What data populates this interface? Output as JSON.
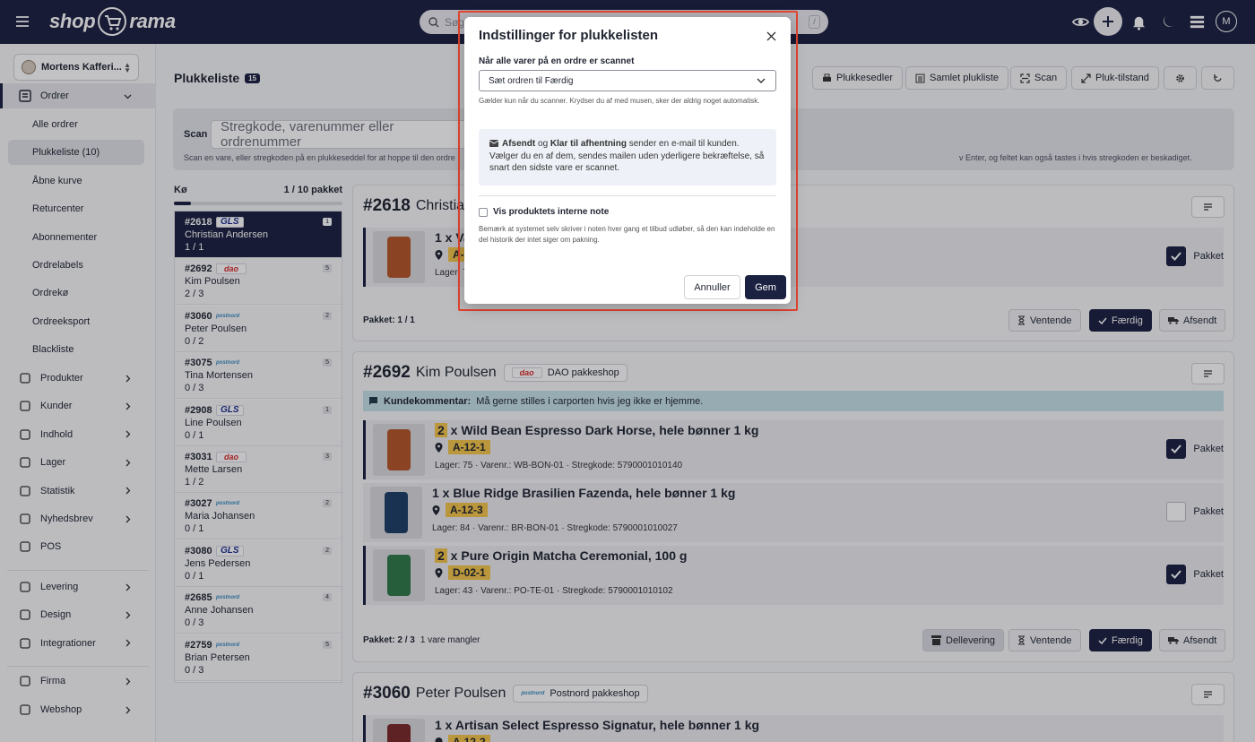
{
  "header": {
    "logo_left": "shop",
    "logo_right": "rama",
    "search_placeholder": "Søg",
    "search_kbd": "/",
    "avatar": "M"
  },
  "sidebar": {
    "shop_name": "Mortens Kafferi...",
    "orders_label": "Ordrer",
    "sub_items": [
      "Alle ordrer",
      "Plukkeliste (10)",
      "Åbne kurve",
      "Returcenter",
      "Abonnementer",
      "Ordrelabels",
      "Ordrekø",
      "Ordreeksport",
      "Blackliste"
    ],
    "items": [
      "Produkter",
      "Kunder",
      "Indhold",
      "Lager",
      "Statistik",
      "Nyhedsbrev",
      "POS"
    ],
    "items2": [
      "Levering",
      "Design",
      "Integrationer"
    ],
    "items3": [
      "Firma",
      "Webshop"
    ]
  },
  "main": {
    "title": "Plukkeliste",
    "count": "15",
    "buttons": [
      "Plukkesedler",
      "Samlet plukliste",
      "Scan",
      "Pluk-tilstand"
    ],
    "scan_label": "Scan",
    "scan_placeholder": "Stregkode, varenummer eller ordrenummer",
    "scan_help": "Scan en vare, eller stregkoden på en plukkeseddel for at hoppe til den ordre",
    "scan_help2": "v Enter, og feltet kan også tastes i hvis stregkoden er beskadiget."
  },
  "queue": {
    "label": "Kø",
    "summary": "1 / 10 pakket",
    "progress": 0.1,
    "items": [
      {
        "num": "#2618",
        "carrier": "GLS",
        "name": "Christian Andersen",
        "prog": "1 / 1",
        "cnt": "1"
      },
      {
        "num": "#2692",
        "carrier": "dao",
        "name": "Kim Poulsen",
        "prog": "2 / 3",
        "cnt": "5"
      },
      {
        "num": "#3060",
        "carrier": "postnord",
        "name": "Peter Poulsen",
        "prog": "0 / 2",
        "cnt": "2"
      },
      {
        "num": "#3075",
        "carrier": "postnord",
        "name": "Tina Mortensen",
        "prog": "0 / 3",
        "cnt": "5"
      },
      {
        "num": "#2908",
        "carrier": "GLS",
        "name": "Line Poulsen",
        "prog": "0 / 1",
        "cnt": "1"
      },
      {
        "num": "#3031",
        "carrier": "dao",
        "name": "Mette Larsen",
        "prog": "1 / 2",
        "cnt": "3"
      },
      {
        "num": "#3027",
        "carrier": "postnord",
        "name": "Maria Johansen",
        "prog": "0 / 1",
        "cnt": "2"
      },
      {
        "num": "#3080",
        "carrier": "GLS",
        "name": "Jens Pedersen",
        "prog": "0 / 1",
        "cnt": "2"
      },
      {
        "num": "#2685",
        "carrier": "postnord",
        "name": "Anne Johansen",
        "prog": "0 / 3",
        "cnt": "4"
      },
      {
        "num": "#2759",
        "carrier": "postnord",
        "name": "Brian Petersen",
        "prog": "0 / 3",
        "cnt": "5"
      }
    ]
  },
  "order1": {
    "num": "#2618",
    "name": "Christian",
    "line_title": "1 x Va",
    "loc": "A-1",
    "meta": "Lager: 7",
    "pak_label": "Pakket",
    "foot": "Pakket: 1 / 1",
    "btn_wait": "Ventende",
    "btn_done": "Færdig",
    "btn_sent": "Afsendt"
  },
  "order2": {
    "num": "#2692",
    "name": "Kim Poulsen",
    "ship_label": "DAO pakkeshop",
    "carrier": "dao",
    "comment_label": "Kundekommentar:",
    "comment": "Må gerne stilles i carporten hvis jeg ikke er hjemme.",
    "lines": [
      {
        "qty": "2",
        "title": " x Wild Bean Espresso Dark Horse, hele bønner 1 kg",
        "loc": "A-12-1",
        "meta": "Lager: 75 · Varenr.: WB-BON-01 · Stregkode: 5790001010140",
        "checked": true,
        "color": "#b5572a"
      },
      {
        "qty": "",
        "title": "1 x Blue Ridge Brasilien Fazenda, hele bønner 1 kg",
        "loc": "A-12-3",
        "meta": "Lager: 84 · Varenr.: BR-BON-01 · Stregkode: 5790001010027",
        "checked": false,
        "color": "#1f3f66"
      },
      {
        "qty": "2",
        "title": " x Pure Origin Matcha Ceremonial, 100 g",
        "loc": "D-02-1",
        "meta": "Lager: 43 · Varenr.: PO-TE-01 · Stregkode: 5790001010102",
        "checked": true,
        "color": "#2f7a4a"
      }
    ],
    "pak_label": "Pakket",
    "foot_pk": "Pakket: 2 / 3",
    "foot_missing": "1 vare mangler",
    "btn_partial": "Dellevering",
    "btn_wait": "Ventende",
    "btn_done": "Færdig",
    "btn_sent": "Afsendt"
  },
  "order3": {
    "num": "#3060",
    "name": "Peter Poulsen",
    "ship_label": "Postnord pakkeshop",
    "carrier": "postnord",
    "line_title": "1 x Artisan Select Espresso Signatur, hele bønner 1 kg",
    "loc": "A-12-2"
  },
  "modal": {
    "title": "Indstillinger for plukkelisten",
    "label1": "Når alle varer på en ordre er scannet",
    "select_value": "Sæt ordren til Færdig",
    "help1": "Gælder kun når du scanner. Krydser du af med musen, sker der aldrig noget automatisk.",
    "info_b1": "Afsendt",
    "info_og": " og ",
    "info_b2": "Klar til afhentning",
    "info_rest": " sender en e-mail til kunden. Vælger du en af dem, sendes mailen uden yderligere bekræftelse, så snart den sidste vare er scannet.",
    "chk_label": "Vis produktets interne note",
    "help2": "Bemærk at systemet selv skriver i noten hver gang et tilbud udløber, så den kan indeholde en del historik der intet siger om pakning.",
    "cancel": "Annuller",
    "save": "Gem"
  },
  "colors": {
    "navy": "#1b2141",
    "highlight": "#f4c64a",
    "modal_border": "#e2442f",
    "comment_bg": "#c6e1e9"
  }
}
